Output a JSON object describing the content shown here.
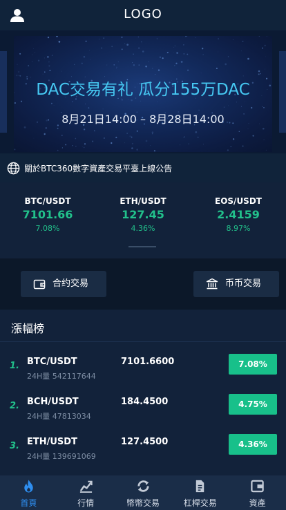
{
  "header": {
    "logo": "LOGO"
  },
  "banner": {
    "title": "DAC交易有礼 瓜分155万DAC",
    "date": "8月21日14:00 – 8月28日14:00"
  },
  "notice": {
    "text": "關於BTC360數字資產交易平臺上線公告"
  },
  "tickers": [
    {
      "pair": "BTC/USDT",
      "price": "7101.66",
      "change": "7.08%"
    },
    {
      "pair": "ETH/USDT",
      "price": "127.45",
      "change": "4.36%"
    },
    {
      "pair": "EOS/USDT",
      "price": "2.4159",
      "change": "8.97%"
    }
  ],
  "actions": {
    "contract": "合约交易",
    "spot": "币币交易"
  },
  "ranking": {
    "title": "漲幅榜",
    "rows": [
      {
        "rank": "1.",
        "pair": "BTC/USDT",
        "volume": "24H量 542117644",
        "price": "7101.6600",
        "change": "7.08%"
      },
      {
        "rank": "2.",
        "pair": "BCH/USDT",
        "volume": "24H量 47813034",
        "price": "184.4500",
        "change": "4.75%"
      },
      {
        "rank": "3.",
        "pair": "ETH/USDT",
        "volume": "24H量 139691069",
        "price": "127.4500",
        "change": "4.36%"
      }
    ]
  },
  "tabbar": {
    "items": [
      {
        "label": "首頁",
        "icon": "flame-icon"
      },
      {
        "label": "行情",
        "icon": "chart-icon"
      },
      {
        "label": "幣幣交易",
        "icon": "exchange-icon"
      },
      {
        "label": "杠桿交易",
        "icon": "document-icon"
      },
      {
        "label": "資產",
        "icon": "wallet-icon"
      }
    ],
    "active_index": 0
  },
  "colors": {
    "accent_green": "#22c18b",
    "active_blue": "#2e8ef0",
    "banner_title": "#46c8f2"
  }
}
